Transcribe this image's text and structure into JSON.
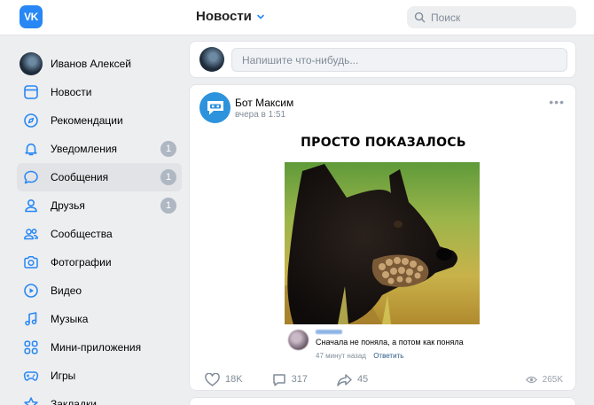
{
  "header": {
    "logo": "VK",
    "title": "Новости",
    "search_placeholder": "Поиск"
  },
  "sidebar": {
    "profile_name": "Иванов Алексей",
    "items": [
      {
        "label": "Новости",
        "icon": "news-icon"
      },
      {
        "label": "Рекомендации",
        "icon": "compass-icon"
      },
      {
        "label": "Уведомления",
        "icon": "bell-icon",
        "badge": "1"
      },
      {
        "label": "Сообщения",
        "icon": "message-icon",
        "badge": "1"
      },
      {
        "label": "Друзья",
        "icon": "user-icon",
        "badge": "1"
      },
      {
        "label": "Сообщества",
        "icon": "users-icon"
      },
      {
        "label": "Фотографии",
        "icon": "camera-icon"
      },
      {
        "label": "Видео",
        "icon": "play-icon"
      },
      {
        "label": "Музыка",
        "icon": "music-icon"
      },
      {
        "label": "Мини-приложения",
        "icon": "apps-icon"
      },
      {
        "label": "Игры",
        "icon": "gamepad-icon"
      },
      {
        "label": "Закладки",
        "icon": "star-icon"
      }
    ]
  },
  "composer": {
    "placeholder": "Напишите что-нибудь..."
  },
  "post": {
    "author": "Бот Максим",
    "time": "вчера в 1:51",
    "meme_caption": "ПРОСТО ПОКАЗАЛОСЬ",
    "quote": {
      "text": "Сначала не поняла, а потом как поняла",
      "meta": "47 минут назад",
      "reply": "Ответить"
    },
    "likes": "18K",
    "comments": "317",
    "shares": "45",
    "views": "265K"
  },
  "colors": {
    "accent": "#2787f5",
    "background": "#edeef0",
    "icon": "#2787f5",
    "muted": "#818c99"
  }
}
